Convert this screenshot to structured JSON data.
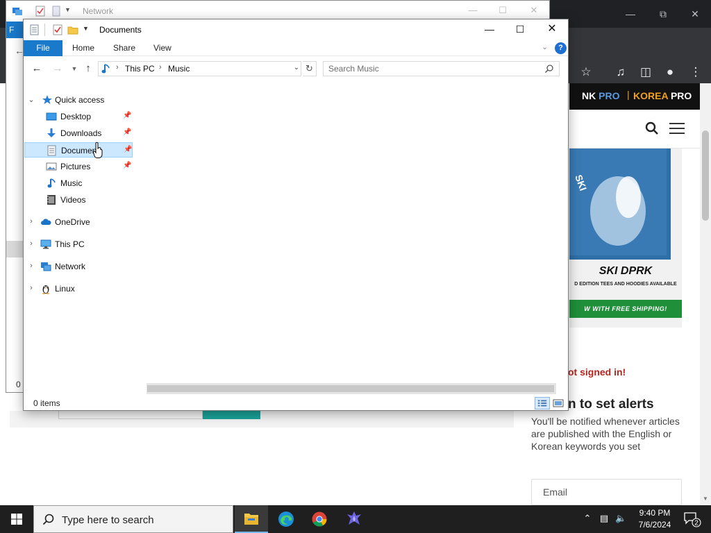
{
  "browser": {
    "site": {
      "nk": "NK",
      "nk_pro": "PRO",
      "divider": "|",
      "korea": "KOREA",
      "korea_pro": "PRO"
    },
    "ad": {
      "title": "SKI DPRK",
      "subtitle": "D EDITION TEES AND HOODIES AVAILABLE",
      "cta": "W WITH FREE SHIPPING!"
    },
    "signin": {
      "not_signed": "ot signed in!",
      "alerts_title": "n to set alerts",
      "alerts_desc": "You'll be notified whenever articles are published with the English or Korean keywords you set",
      "email_placeholder": "Email"
    }
  },
  "network_window": {
    "title": "Network",
    "ribbon_file": "F",
    "status": "0 i"
  },
  "explorer": {
    "title": "Documents",
    "ribbon": {
      "file": "File",
      "tabs": [
        "Home",
        "Share",
        "View"
      ],
      "help": "?"
    },
    "address": {
      "crumbs": [
        "This PC",
        "Music"
      ]
    },
    "search": {
      "placeholder": "Search Music"
    },
    "nav": {
      "quick_access": "Quick access",
      "pinned": [
        {
          "label": "Desktop"
        },
        {
          "label": "Downloads"
        },
        {
          "label": "Documents"
        },
        {
          "label": "Pictures"
        },
        {
          "label": "Music"
        },
        {
          "label": "Videos"
        }
      ],
      "onedrive": "OneDrive",
      "this_pc": "This PC",
      "network": "Network",
      "linux": "Linux"
    },
    "status": "0 items",
    "accent": "#1979ca"
  },
  "taskbar": {
    "search_text": "Type here to search",
    "time": "9:40 PM",
    "date": "7/6/2024",
    "notifications": "2"
  }
}
